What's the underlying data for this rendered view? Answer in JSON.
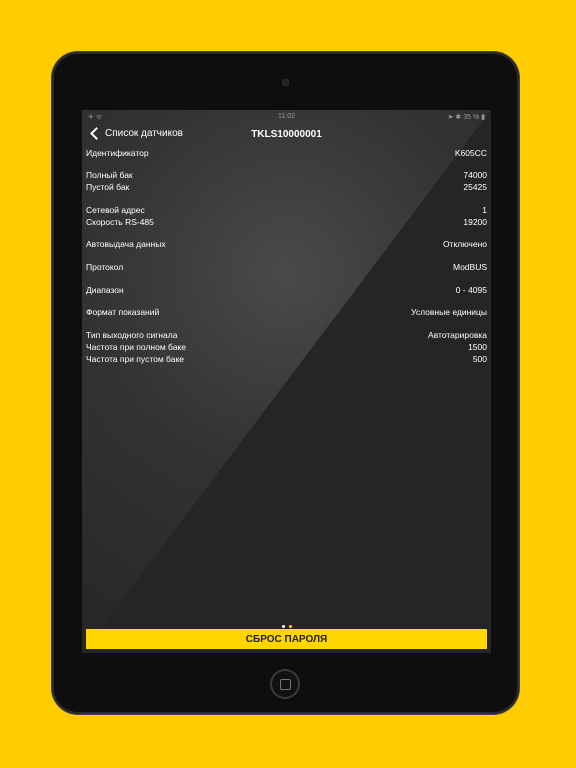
{
  "status": {
    "left": "✈ ᯤ",
    "time": "11:02",
    "right": "➤ ✱ 35 % ▮"
  },
  "nav": {
    "back_label": "Список датчиков",
    "title": "TKLS10000001"
  },
  "rows": [
    {
      "key": "Идентификатор",
      "value": "K605CC"
    },
    {
      "key": "Полный бак",
      "value": "74000"
    },
    {
      "key": "Пустой бак",
      "value": "25425"
    },
    {
      "key": "Сетевой адрес",
      "value": "1"
    },
    {
      "key": "Скорость RS-485",
      "value": "19200"
    },
    {
      "key": "Автовыдача данных",
      "value": "Отключено"
    },
    {
      "key": "Протокол",
      "value": "ModBUS"
    },
    {
      "key": "Диапазон",
      "value": "0 - 4095"
    },
    {
      "key": "Формат показаний",
      "value": "Условные единицы"
    },
    {
      "key": "Тип выходного сигнала",
      "value": "Автотарировка"
    },
    {
      "key": "Частота при полном баке",
      "value": "1500"
    },
    {
      "key": "Частота при пустом баке",
      "value": "500"
    }
  ],
  "pager": {
    "count": 2,
    "active": 1,
    "color_inactive": "#ffffff",
    "color_active": "#FFD600"
  },
  "reset_button": "СБРОС ПАРОЛЯ",
  "colors": {
    "background": "#FFCC00",
    "accent": "#FFD600"
  },
  "icons": {
    "back": "chevron-left-icon",
    "home": "home-button-icon"
  }
}
